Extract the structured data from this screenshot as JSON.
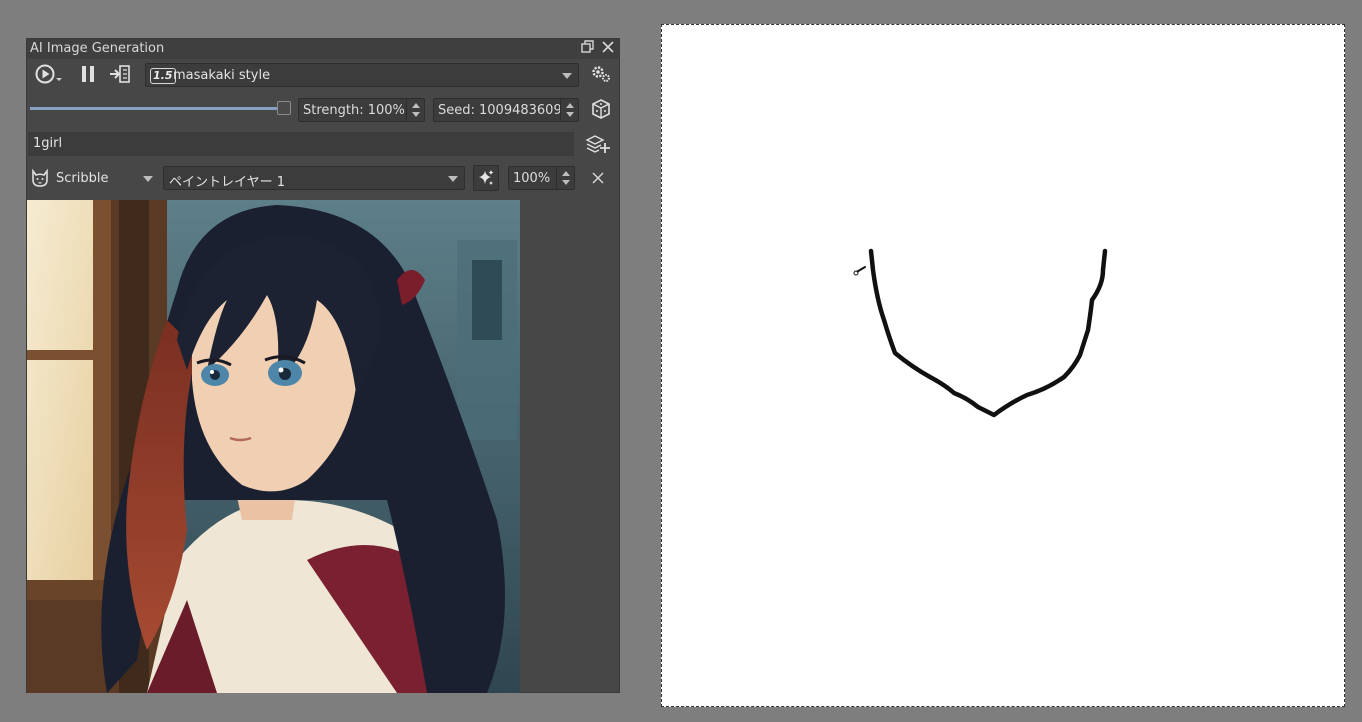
{
  "panel": {
    "title": "AI Image Generation",
    "model": {
      "badge": "1.5",
      "name": "masakaki style"
    },
    "strength": {
      "label": "Strength: 100%",
      "value": 100
    },
    "seed": {
      "label": "Seed: 1009483609"
    },
    "prompt": {
      "value": "1girl"
    },
    "control": {
      "type": "Scribble",
      "layer": "ペイントレイヤー 1",
      "strength": "100%"
    }
  },
  "icons": {
    "float": "restore-window-icon",
    "close": "close-icon",
    "generate": "play-circle-icon",
    "pause": "pause-icon",
    "apply": "insert-result-icon",
    "settings": "settings-gears-icon",
    "seed_random": "dice-icon",
    "add_control": "add-control-layer-icon",
    "control_type": "scribble-cat-icon",
    "control_from_image": "sparkle-icon",
    "remove_control": "close-icon"
  },
  "colors": {
    "panel_bg": "#474747",
    "canvas_bg": "#ffffff",
    "background": "#7e7e7e",
    "slider_accent": "#8aa2c2",
    "stroke": "#111111"
  }
}
